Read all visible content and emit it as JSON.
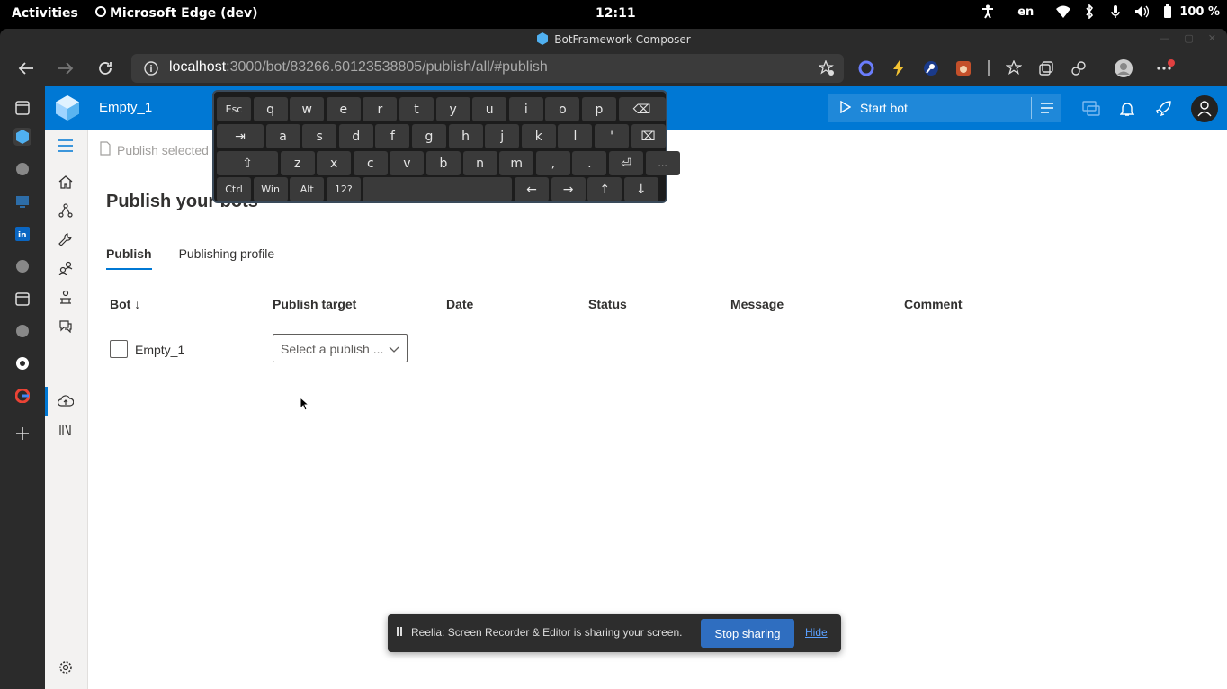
{
  "system_bar": {
    "activities": "Activities",
    "app_name": "Microsoft Edge (dev)",
    "clock": "12:11",
    "language": "en",
    "battery": "100 %"
  },
  "browser": {
    "window_title": "BotFramework Composer",
    "url_host": "localhost",
    "url_path": ":3000/bot/83266.60123538805/publish/all/#publish"
  },
  "app": {
    "bot_name": "Empty_1",
    "start_bot_label": "Start bot",
    "accent": "#0078d4",
    "command_bar": "Publish selected bots",
    "page_title": "Publish your bots",
    "tabs": [
      {
        "label": "Publish",
        "active": true
      },
      {
        "label": "Publishing profile",
        "active": false
      }
    ],
    "table": {
      "headers": [
        "Bot ↓",
        "Publish target",
        "Date",
        "Status",
        "Message",
        "Comment"
      ],
      "rows": [
        {
          "bot": "Empty_1",
          "publish_target_placeholder": "Select a publish ...",
          "checked": false
        }
      ]
    }
  },
  "keyboard": {
    "row1": [
      "Esc",
      "q",
      "w",
      "e",
      "r",
      "t",
      "y",
      "u",
      "i",
      "o",
      "p",
      "⌫"
    ],
    "row2": [
      "⇥",
      "a",
      "s",
      "d",
      "f",
      "g",
      "h",
      "j",
      "k",
      "l",
      "'",
      "⌧"
    ],
    "row3": [
      "⇧",
      "z",
      "x",
      "c",
      "v",
      "b",
      "n",
      "m",
      ",",
      ".",
      "⏎",
      "..."
    ],
    "row4": [
      "Ctrl",
      "Win",
      "Alt",
      "12?",
      "",
      "←",
      "→",
      "↑",
      "↓"
    ]
  },
  "share_toast": {
    "message": "Reelia: Screen Recorder & Editor is sharing your screen.",
    "stop_label": "Stop sharing",
    "hide_label": "Hide"
  }
}
